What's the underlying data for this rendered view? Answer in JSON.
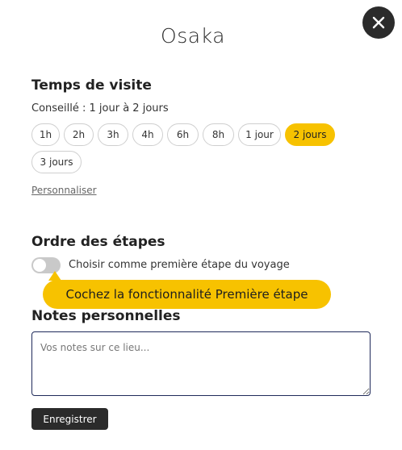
{
  "header": {
    "title": "Osaka",
    "close_icon": "close-icon"
  },
  "visit_time": {
    "title": "Temps de visite",
    "advice": "Conseillé : 1 jour à 2 jours",
    "options": [
      "1h",
      "2h",
      "3h",
      "4h",
      "6h",
      "8h",
      "1 jour",
      "2 jours",
      "3 jours"
    ],
    "selected": "2 jours",
    "customize_label": "Personnaliser"
  },
  "order": {
    "title": "Ordre des étapes",
    "toggle_label": "Choisir comme première étape du voyage",
    "toggle_on": false
  },
  "tooltip": {
    "text": "Cochez la fonctionnalité Première étape"
  },
  "notes": {
    "title": "Notes personnelles",
    "placeholder": "Vos notes sur ce lieu...",
    "value": ""
  },
  "actions": {
    "save_label": "Enregistrer"
  },
  "colors": {
    "accent": "#f7c200",
    "dark": "#2b2b2b",
    "toggle_off": "#c9c9c9"
  }
}
